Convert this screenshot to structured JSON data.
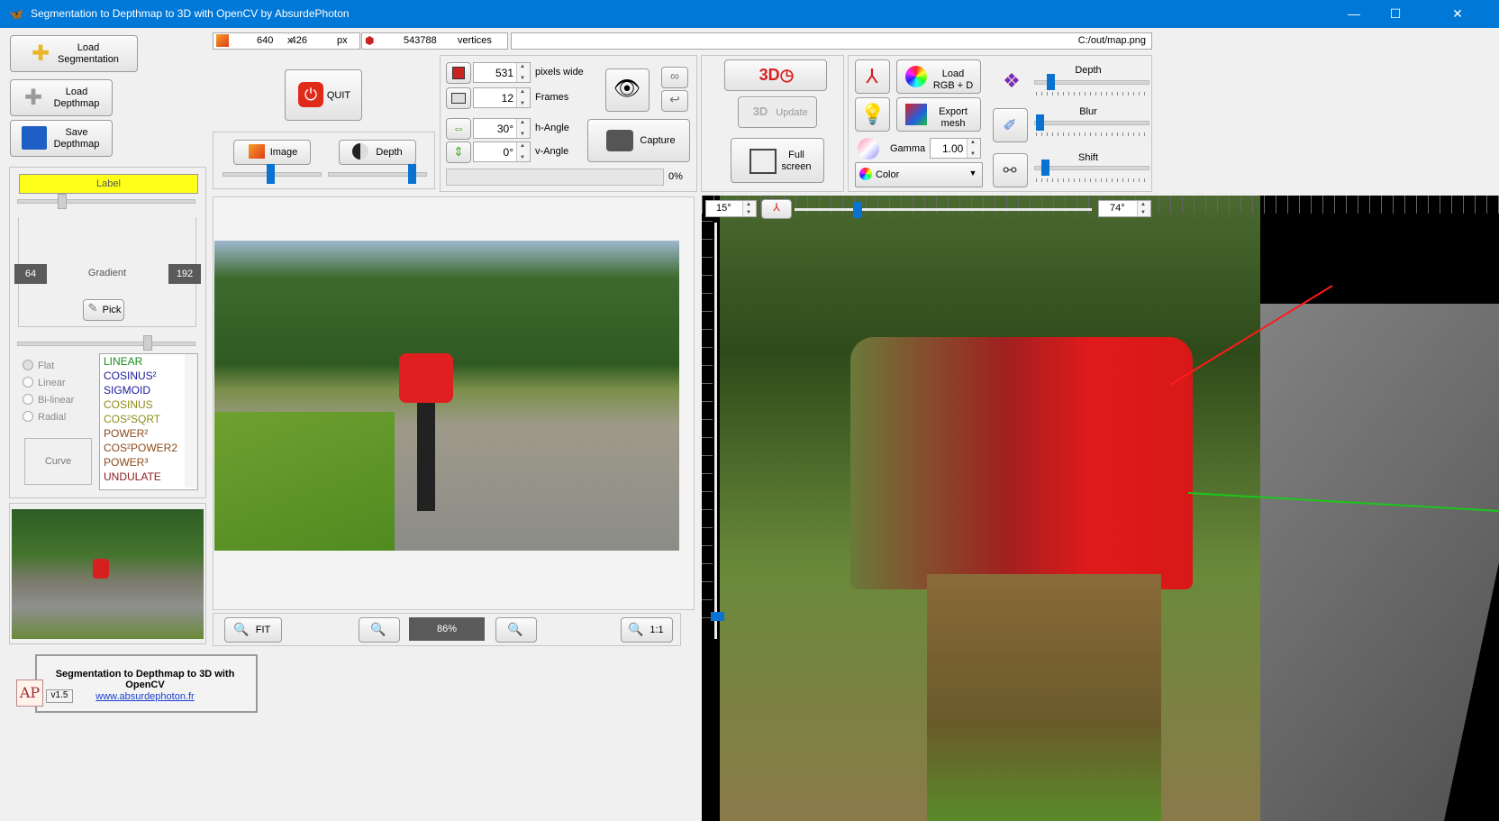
{
  "window": {
    "title": "Segmentation to Depthmap to 3D with OpenCV by AbsurdePhoton",
    "minimize": "—",
    "maximize": "☐",
    "close": "✕"
  },
  "left": {
    "load_segmentation": "Load Segmentation",
    "load_depthmap": "Load Depthmap",
    "save_depthmap": "Save Depthmap",
    "label_text": "Label",
    "gradient_label": "Gradient",
    "gradient_low": "64",
    "gradient_high": "192",
    "pick_label": "Pick",
    "gradient_types": [
      "Flat",
      "Linear",
      "Bi-linear",
      "Radial"
    ],
    "curve_label": "Curve",
    "curves": [
      {
        "text": "LINEAR",
        "color": "#1a8c1a"
      },
      {
        "text": "COSINUS²",
        "color": "#1a1a9c"
      },
      {
        "text": "SIGMOID",
        "color": "#1a1a9c"
      },
      {
        "text": "COSINUS",
        "color": "#8c8c1a"
      },
      {
        "text": "COS²SQRT",
        "color": "#8c8c1a"
      },
      {
        "text": "POWER²",
        "color": "#8c4a1a"
      },
      {
        "text": "COS²POWER2",
        "color": "#8c4a1a"
      },
      {
        "text": "POWER³",
        "color": "#8c4a1a"
      },
      {
        "text": "UNDULATE",
        "color": "#8c1a1a"
      }
    ]
  },
  "info": {
    "width_px": "640",
    "times": "x",
    "height_px": "426",
    "px_unit": "px",
    "vertices": "543788",
    "vertices_label": "vertices",
    "path": "C:/out/map.png"
  },
  "controls": {
    "quit": "QUIT",
    "image_tab": "Image",
    "depth_tab": "Depth",
    "pixels_wide_value": "531",
    "pixels_wide_label": "pixels wide",
    "frames_value": "12",
    "frames_label": "Frames",
    "h_angle_value": "30°",
    "h_angle_label": "h-Angle",
    "v_angle_value": "0°",
    "v_angle_label": "v-Angle",
    "capture": "Capture",
    "progress_value": 0,
    "progress_text": "0%",
    "update": "Update",
    "full_screen": "Full screen",
    "load_rgbd": "Load RGB + D",
    "export_mesh": "Export mesh",
    "gamma_label": "Gamma",
    "gamma_value": "1.00",
    "color_select": "Color",
    "depth_label": "Depth",
    "blur_label": "Blur",
    "shift_label": "Shift"
  },
  "viewer": {
    "fit": "FIT",
    "zoom_value": "86%",
    "one_to_one": "1:1"
  },
  "view3d": {
    "left_angle": "15°",
    "right_angle": "74°"
  },
  "about": {
    "title": "Segmentation to Depthmap to 3D with OpenCV",
    "version": "v1.5",
    "link": "www.absurdephoton.fr",
    "logo": "AP"
  }
}
